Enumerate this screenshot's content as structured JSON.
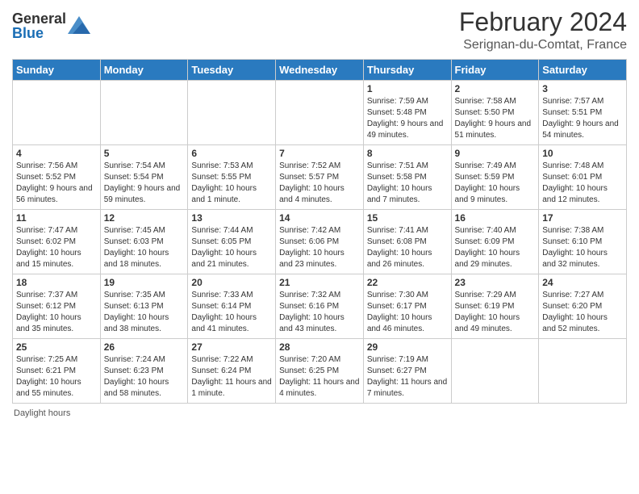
{
  "logo": {
    "general": "General",
    "blue": "Blue"
  },
  "title": "February 2024",
  "subtitle": "Serignan-du-Comtat, France",
  "footer": "Daylight hours",
  "days_header": [
    "Sunday",
    "Monday",
    "Tuesday",
    "Wednesday",
    "Thursday",
    "Friday",
    "Saturday"
  ],
  "weeks": [
    [
      {
        "day": "",
        "info": ""
      },
      {
        "day": "",
        "info": ""
      },
      {
        "day": "",
        "info": ""
      },
      {
        "day": "",
        "info": ""
      },
      {
        "day": "1",
        "info": "Sunrise: 7:59 AM\nSunset: 5:48 PM\nDaylight: 9 hours and 49 minutes."
      },
      {
        "day": "2",
        "info": "Sunrise: 7:58 AM\nSunset: 5:50 PM\nDaylight: 9 hours and 51 minutes."
      },
      {
        "day": "3",
        "info": "Sunrise: 7:57 AM\nSunset: 5:51 PM\nDaylight: 9 hours and 54 minutes."
      }
    ],
    [
      {
        "day": "4",
        "info": "Sunrise: 7:56 AM\nSunset: 5:52 PM\nDaylight: 9 hours and 56 minutes."
      },
      {
        "day": "5",
        "info": "Sunrise: 7:54 AM\nSunset: 5:54 PM\nDaylight: 9 hours and 59 minutes."
      },
      {
        "day": "6",
        "info": "Sunrise: 7:53 AM\nSunset: 5:55 PM\nDaylight: 10 hours and 1 minute."
      },
      {
        "day": "7",
        "info": "Sunrise: 7:52 AM\nSunset: 5:57 PM\nDaylight: 10 hours and 4 minutes."
      },
      {
        "day": "8",
        "info": "Sunrise: 7:51 AM\nSunset: 5:58 PM\nDaylight: 10 hours and 7 minutes."
      },
      {
        "day": "9",
        "info": "Sunrise: 7:49 AM\nSunset: 5:59 PM\nDaylight: 10 hours and 9 minutes."
      },
      {
        "day": "10",
        "info": "Sunrise: 7:48 AM\nSunset: 6:01 PM\nDaylight: 10 hours and 12 minutes."
      }
    ],
    [
      {
        "day": "11",
        "info": "Sunrise: 7:47 AM\nSunset: 6:02 PM\nDaylight: 10 hours and 15 minutes."
      },
      {
        "day": "12",
        "info": "Sunrise: 7:45 AM\nSunset: 6:03 PM\nDaylight: 10 hours and 18 minutes."
      },
      {
        "day": "13",
        "info": "Sunrise: 7:44 AM\nSunset: 6:05 PM\nDaylight: 10 hours and 21 minutes."
      },
      {
        "day": "14",
        "info": "Sunrise: 7:42 AM\nSunset: 6:06 PM\nDaylight: 10 hours and 23 minutes."
      },
      {
        "day": "15",
        "info": "Sunrise: 7:41 AM\nSunset: 6:08 PM\nDaylight: 10 hours and 26 minutes."
      },
      {
        "day": "16",
        "info": "Sunrise: 7:40 AM\nSunset: 6:09 PM\nDaylight: 10 hours and 29 minutes."
      },
      {
        "day": "17",
        "info": "Sunrise: 7:38 AM\nSunset: 6:10 PM\nDaylight: 10 hours and 32 minutes."
      }
    ],
    [
      {
        "day": "18",
        "info": "Sunrise: 7:37 AM\nSunset: 6:12 PM\nDaylight: 10 hours and 35 minutes."
      },
      {
        "day": "19",
        "info": "Sunrise: 7:35 AM\nSunset: 6:13 PM\nDaylight: 10 hours and 38 minutes."
      },
      {
        "day": "20",
        "info": "Sunrise: 7:33 AM\nSunset: 6:14 PM\nDaylight: 10 hours and 41 minutes."
      },
      {
        "day": "21",
        "info": "Sunrise: 7:32 AM\nSunset: 6:16 PM\nDaylight: 10 hours and 43 minutes."
      },
      {
        "day": "22",
        "info": "Sunrise: 7:30 AM\nSunset: 6:17 PM\nDaylight: 10 hours and 46 minutes."
      },
      {
        "day": "23",
        "info": "Sunrise: 7:29 AM\nSunset: 6:19 PM\nDaylight: 10 hours and 49 minutes."
      },
      {
        "day": "24",
        "info": "Sunrise: 7:27 AM\nSunset: 6:20 PM\nDaylight: 10 hours and 52 minutes."
      }
    ],
    [
      {
        "day": "25",
        "info": "Sunrise: 7:25 AM\nSunset: 6:21 PM\nDaylight: 10 hours and 55 minutes."
      },
      {
        "day": "26",
        "info": "Sunrise: 7:24 AM\nSunset: 6:23 PM\nDaylight: 10 hours and 58 minutes."
      },
      {
        "day": "27",
        "info": "Sunrise: 7:22 AM\nSunset: 6:24 PM\nDaylight: 11 hours and 1 minute."
      },
      {
        "day": "28",
        "info": "Sunrise: 7:20 AM\nSunset: 6:25 PM\nDaylight: 11 hours and 4 minutes."
      },
      {
        "day": "29",
        "info": "Sunrise: 7:19 AM\nSunset: 6:27 PM\nDaylight: 11 hours and 7 minutes."
      },
      {
        "day": "",
        "info": ""
      },
      {
        "day": "",
        "info": ""
      }
    ]
  ]
}
